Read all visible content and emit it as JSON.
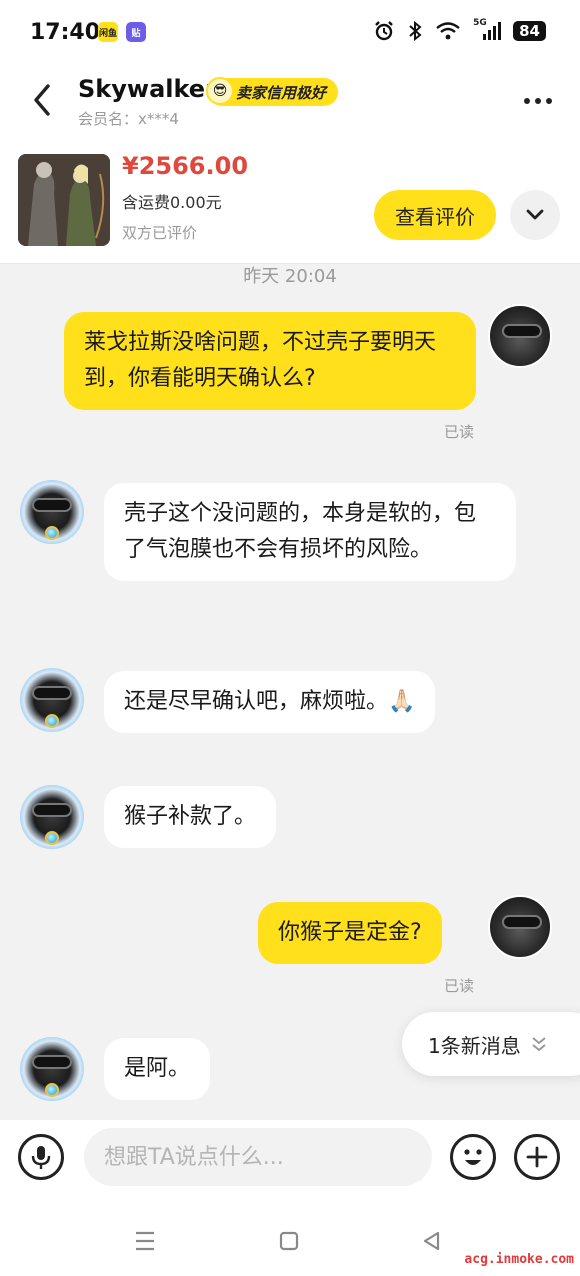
{
  "status_bar": {
    "time": "17:40",
    "app_icon_1": "闲鱼",
    "app_icon_2": "贴",
    "network": "5G",
    "battery": "84"
  },
  "header": {
    "back_icon": "chevron-left-icon",
    "seller_name": "Skywalker",
    "credit_badge": "卖家信用极好",
    "credit_emoji": "😎",
    "member_id": "会员名：x***4",
    "more_icon": "more-dots-icon"
  },
  "product": {
    "price": "¥2566.00",
    "shipping": "含运费0.00元",
    "review_status": "双方已评价",
    "view_review_button": "查看评价",
    "expand_icon": "chevron-down-icon"
  },
  "chat": {
    "timestamp": "昨天 20:04",
    "messages": [
      {
        "sender": "me",
        "text": "莱戈拉斯没啥问题，不过壳子要明天到，你看能明天确认么?",
        "read": "已读"
      },
      {
        "sender": "other",
        "text": "壳子这个没问题的，本身是软的，包了气泡膜也不会有损坏的风险。"
      },
      {
        "sender": "other",
        "text": "还是尽早确认吧，麻烦啦。🙏🏻"
      },
      {
        "sender": "other",
        "text": "猴子补款了。"
      },
      {
        "sender": "me",
        "text": "你猴子是定金?",
        "read": "已读"
      },
      {
        "sender": "other",
        "text": "是阿。"
      }
    ],
    "new_message_pill": "1条新消息"
  },
  "input_bar": {
    "placeholder": "想跟TA说点什么...",
    "voice_icon": "microphone-icon",
    "emoji_icon": "emoji-icon",
    "plus_icon": "plus-icon"
  },
  "nav_bar": {
    "menu_icon": "menu-icon",
    "home_icon": "home-square-icon",
    "back_icon": "back-triangle-icon",
    "watermark": "acg.inmoke.com"
  },
  "colors": {
    "accent_yellow": "#ffe01b",
    "price_red": "#e0483d",
    "background": "#f2f2f2"
  }
}
